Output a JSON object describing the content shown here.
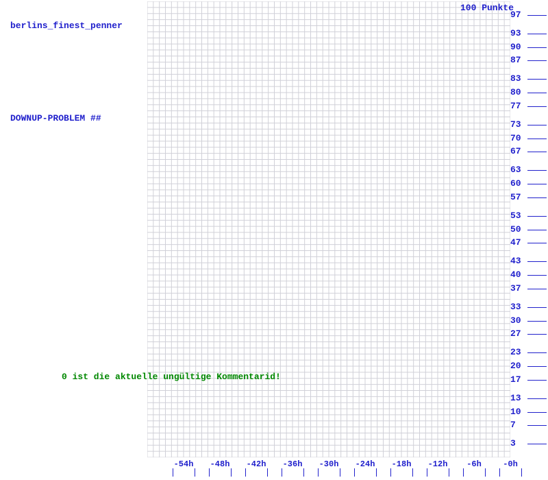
{
  "labels": {
    "user": "berlins_finest_penner",
    "problem": "DOWNUP-PROBLEM ##",
    "footer": "0 ist die aktuelle ungültige Kommentarid!"
  },
  "chart_data": {
    "type": "line",
    "title": "",
    "xlabel": "",
    "ylabel": "100 Punkte",
    "x_ticks": [
      "-54h",
      "-48h",
      "-42h",
      "-36h",
      "-30h",
      "-24h",
      "-18h",
      "-12h",
      "-6h",
      "-0h"
    ],
    "y_ticks": [
      3,
      7,
      10,
      13,
      17,
      20,
      23,
      27,
      30,
      33,
      37,
      40,
      43,
      47,
      50,
      53,
      57,
      60,
      63,
      67,
      70,
      73,
      77,
      80,
      83,
      87,
      90,
      93,
      97
    ],
    "xlim": [
      -60,
      0
    ],
    "ylim": [
      0,
      100
    ],
    "series": [],
    "grid": true
  }
}
